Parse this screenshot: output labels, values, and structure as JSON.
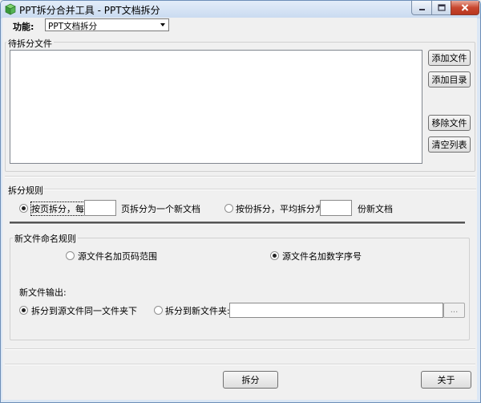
{
  "window": {
    "title": "PPT拆分合并工具 - PPT文档拆分"
  },
  "function": {
    "label": "功能:",
    "selected": "PPT文档拆分"
  },
  "files_group": {
    "title": "待拆分文件",
    "buttons": {
      "add_file": "添加文件",
      "add_folder": "添加目录",
      "remove_file": "移除文件",
      "clear_list": "清空列表"
    }
  },
  "split_rules": {
    "title": "拆分规则",
    "by_page_label": "按页拆分，每",
    "by_page_suffix": "页拆分为一个新文档",
    "by_page_value": "",
    "by_count_label": "按份拆分，平均拆分为",
    "by_count_suffix": "份新文档",
    "by_count_value": ""
  },
  "naming": {
    "title": "新文件命名规则",
    "option_page_range": "源文件名加页码范围",
    "option_number": "源文件名加数字序号"
  },
  "output": {
    "label": "新文件输出:",
    "same_folder": "拆分到源文件同一文件夹下",
    "new_folder": "拆分到新文件夹:",
    "folder_path": "",
    "browse_label": "..."
  },
  "footer": {
    "split_button": "拆分",
    "close_button": "关于"
  },
  "colors": {
    "accent_green": "#3b9a3b",
    "close_red": "#c8472f"
  }
}
